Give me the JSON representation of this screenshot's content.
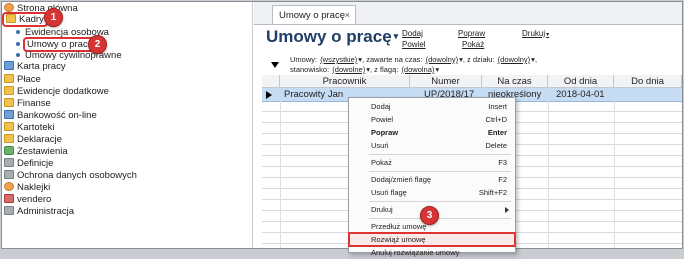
{
  "sidebar": {
    "items": [
      {
        "label": "Strona główna",
        "icon": "home-icon"
      },
      {
        "label": "Kadry",
        "icon": "folder-icon"
      },
      {
        "label": "Ewidencja osobowa"
      },
      {
        "label": "Umowy o pracę"
      },
      {
        "label": "Umowy cywilnoprawne"
      },
      {
        "label": "Karta pracy",
        "icon": "card-icon"
      },
      {
        "label": "Płace",
        "icon": "folder-icon"
      },
      {
        "label": "Ewidencje dodatkowe",
        "icon": "folder-icon"
      },
      {
        "label": "Finanse",
        "icon": "folder-icon"
      },
      {
        "label": "Bankowość on-line",
        "icon": "bank-icon"
      },
      {
        "label": "Kartoteki",
        "icon": "folder-icon"
      },
      {
        "label": "Deklaracje",
        "icon": "folder-icon"
      },
      {
        "label": "Zestawienia",
        "icon": "chart-icon"
      },
      {
        "label": "Definicje",
        "icon": "gear-icon"
      },
      {
        "label": "Ochrona danych osobowych",
        "icon": "lock-icon"
      },
      {
        "label": "Naklejki",
        "icon": "tag-icon"
      },
      {
        "label": "vendero",
        "icon": "vendero-icon"
      },
      {
        "label": "Administracja",
        "icon": "admin-icon"
      }
    ],
    "badges": [
      "1",
      "2",
      "3"
    ]
  },
  "tab": {
    "label": "Umowy o pracę",
    "close": "×"
  },
  "page": {
    "title": "Umowy o pracę",
    "title_caret": "▾"
  },
  "toplinks": {
    "dodaj": "Dodaj",
    "popraw": "Popraw",
    "drukuj": "Drukuj",
    "powiel": "Powiel",
    "pokaz": "Pokaż"
  },
  "filters": {
    "umowy_label": "Umowy:",
    "umowy_value": "(wszystkie)",
    "zawarte_label": ", zawarte na czas:",
    "zawarte_value": "(dowolny)",
    "dzial_label": ", z działu:",
    "dzial_value": "(dowolny)",
    "stanowisko_label": "stanowisko:",
    "stanowisko_value": "(dowolne)",
    "flaga_label": ", z flagą:",
    "flaga_value": "(dowolna)",
    "caret": "▾",
    "end_comma": ","
  },
  "grid": {
    "columns": [
      "Pracownik",
      "Numer",
      "Na czas",
      "Od dnia",
      "Do dnia"
    ],
    "rows": [
      [
        "Pracowity Jan",
        "UP/2018/17",
        "nieokreślony",
        "2018-04-01",
        ""
      ]
    ]
  },
  "context_menu": {
    "items": [
      {
        "label": "Dodaj",
        "shortcut": "Insert"
      },
      {
        "label": "Powiel",
        "shortcut": "Ctrl+D"
      },
      {
        "label": "Popraw",
        "shortcut": "Enter",
        "bold": true
      },
      {
        "label": "Usuń",
        "shortcut": "Delete"
      },
      {
        "label": "Pokaż",
        "shortcut": "F3"
      },
      {
        "label": "Dodaj/zmień flagę",
        "shortcut": "F2"
      },
      {
        "label": "Usuń flagę",
        "shortcut": "Shift+F2"
      },
      {
        "label": "Drukuj",
        "shortcut": ""
      },
      {
        "label": "Przedłuż umowę",
        "shortcut": ""
      },
      {
        "label": "Rozwiąż umowę",
        "shortcut": "",
        "highlighted": true
      },
      {
        "label": "Anuluj rozwiązanie umowy",
        "shortcut": ""
      }
    ]
  },
  "colors": {
    "accent_red": "#d33",
    "title_blue": "#1f3f66",
    "selection": "#c6dcf3"
  }
}
